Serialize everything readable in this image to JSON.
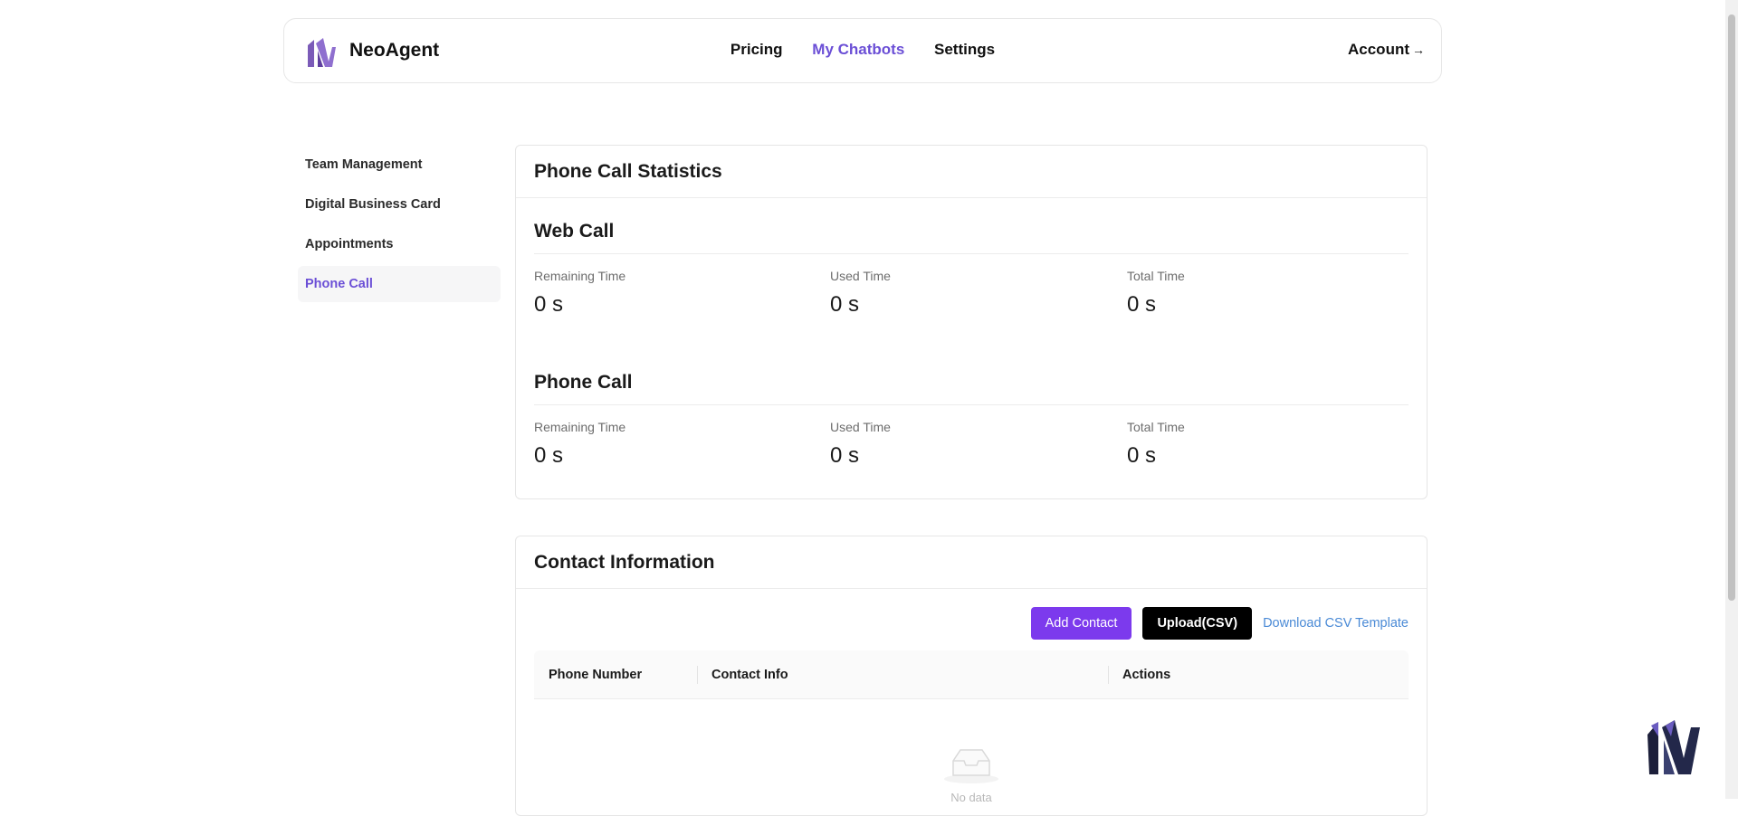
{
  "brand": {
    "name": "NeoAgent",
    "logo_icon": "neoagent-logo-icon"
  },
  "nav": {
    "items": [
      {
        "label": "Pricing",
        "active": false
      },
      {
        "label": "My Chatbots",
        "active": true
      },
      {
        "label": "Settings",
        "active": false
      }
    ],
    "account_label": "Account",
    "account_arrow": "→"
  },
  "sidebar": {
    "items": [
      {
        "label": "Team Management",
        "active": false
      },
      {
        "label": "Digital Business Card",
        "active": false
      },
      {
        "label": "Appointments",
        "active": false
      },
      {
        "label": "Phone Call",
        "active": true
      }
    ]
  },
  "stats": {
    "title": "Phone Call Statistics",
    "web_call": {
      "title": "Web Call",
      "remaining_label": "Remaining Time",
      "remaining_value": "0 s",
      "used_label": "Used Time",
      "used_value": "0 s",
      "total_label": "Total Time",
      "total_value": "0 s"
    },
    "phone_call": {
      "title": "Phone Call",
      "remaining_label": "Remaining Time",
      "remaining_value": "0 s",
      "used_label": "Used Time",
      "used_value": "0 s",
      "total_label": "Total Time",
      "total_value": "0 s"
    }
  },
  "contacts": {
    "title": "Contact Information",
    "add_button": "Add Contact",
    "upload_button": "Upload(CSV)",
    "download_link": "Download CSV Template",
    "columns": [
      "Phone Number",
      "Contact Info",
      "Actions"
    ],
    "empty_text": "No data"
  },
  "colors": {
    "accent": "#6b4fd6",
    "primary_button": "#7c3aed",
    "link": "#4a8ad6"
  }
}
